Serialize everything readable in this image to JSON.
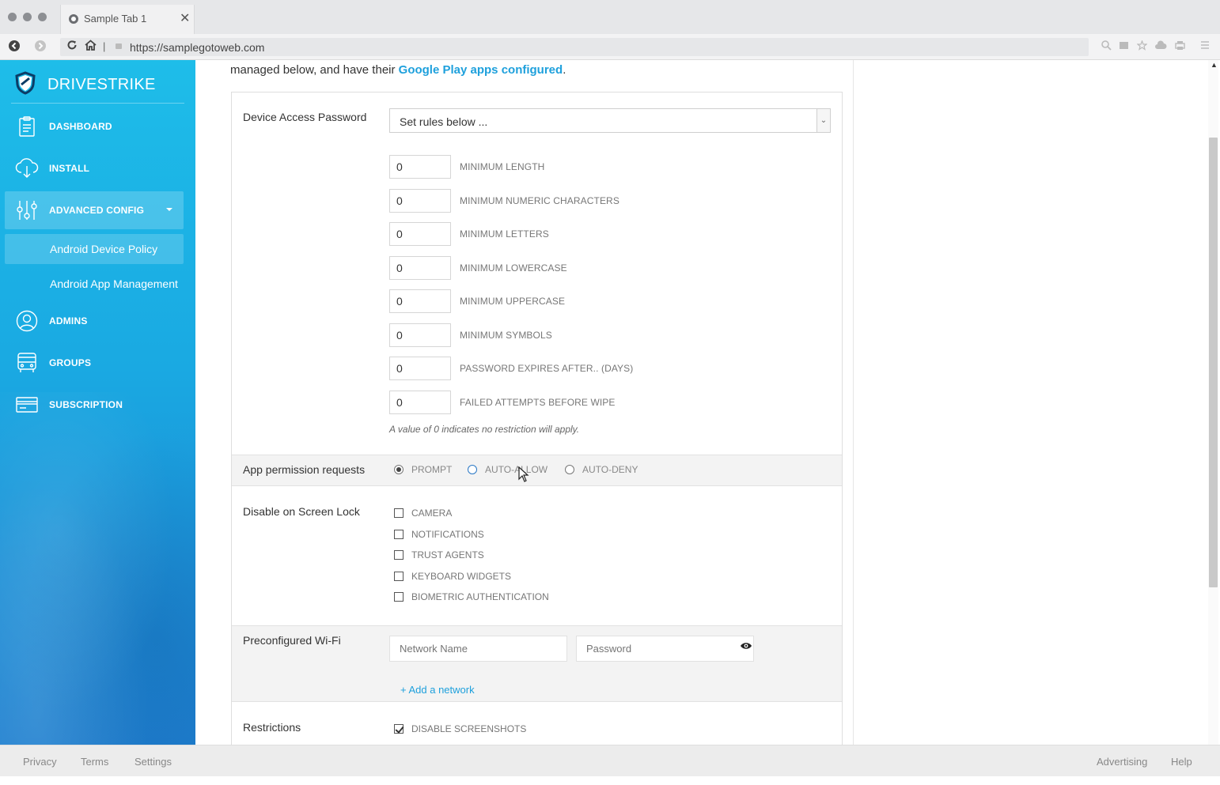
{
  "browser": {
    "tab_title": "Sample Tab 1",
    "tab_close": "✕",
    "url": "https://samplegotoweb.com"
  },
  "sidebar": {
    "brand": "DRIVESTRIKE",
    "items": [
      {
        "label": "DASHBOARD",
        "icon": "clipboard-icon"
      },
      {
        "label": "INSTALL",
        "icon": "cloud-download-icon"
      },
      {
        "label": "ADVANCED CONFIG",
        "icon": "sliders-icon"
      },
      {
        "label": "ADMINS",
        "icon": "user-circle-icon"
      },
      {
        "label": "GROUPS",
        "icon": "bus-icon"
      },
      {
        "label": "SUBSCRIPTION",
        "icon": "credit-card-icon"
      }
    ],
    "sub_items": [
      {
        "label": "Android Device Policy"
      },
      {
        "label": "Android App Management"
      }
    ]
  },
  "main": {
    "intro_text": "managed below, and have their ",
    "intro_link": "Google Play apps configured",
    "intro_end": ".",
    "device_password": {
      "label": "Device Access Password",
      "selected": "Set rules below ...",
      "fields": [
        {
          "label": "MINIMUM LENGTH",
          "value": "0"
        },
        {
          "label": "MINIMUM NUMERIC CHARACTERS",
          "value": "0"
        },
        {
          "label": "MINIMUM LETTERS",
          "value": "0"
        },
        {
          "label": "MINIMUM LOWERCASE",
          "value": "0"
        },
        {
          "label": "MINIMUM UPPERCASE",
          "value": "0"
        },
        {
          "label": "MINIMUM SYMBOLS",
          "value": "0"
        },
        {
          "label": "PASSWORD EXPIRES AFTER.. (DAYS)",
          "value": "0"
        },
        {
          "label": "FAILED ATTEMPTS BEFORE WIPE",
          "value": "0"
        }
      ],
      "hint": "A value of 0 indicates no restriction will apply."
    },
    "app_permission": {
      "label": "App permission requests",
      "options": [
        "PROMPT",
        "AUTO-ALLOW",
        "AUTO-DENY"
      ],
      "selected": "PROMPT"
    },
    "screen_lock": {
      "label": "Disable on Screen Lock",
      "options": [
        {
          "label": "CAMERA",
          "checked": false
        },
        {
          "label": "NOTIFICATIONS",
          "checked": false
        },
        {
          "label": "TRUST AGENTS",
          "checked": false
        },
        {
          "label": "KEYBOARD WIDGETS",
          "checked": false
        },
        {
          "label": "BIOMETRIC AUTHENTICATION",
          "checked": false
        }
      ]
    },
    "wifi": {
      "label": "Preconfigured Wi-Fi",
      "network_placeholder": "Network Name",
      "password_placeholder": "Password",
      "add_link": "+ Add a network"
    },
    "restrictions": {
      "label": "Restrictions",
      "options": [
        {
          "label": "DISABLE SCREENSHOTS",
          "checked": true
        }
      ]
    }
  },
  "footer": {
    "left": [
      "Privacy",
      "Terms",
      "Settings"
    ],
    "right": [
      "Advertising",
      "Help"
    ]
  },
  "colors": {
    "accent": "#1ea0dc",
    "sidebar_top": "#1ebde9",
    "sidebar_bottom": "#1e7fcf"
  }
}
